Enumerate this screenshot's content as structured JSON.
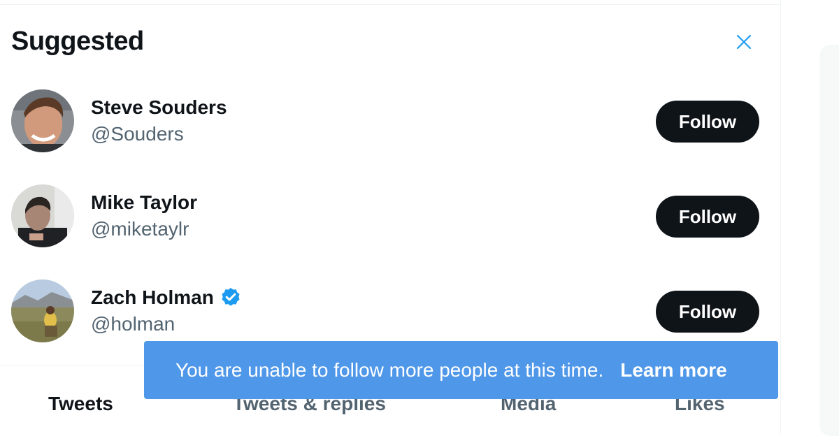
{
  "suggested": {
    "title": "Suggested",
    "close_icon": "close-icon",
    "users": [
      {
        "name": "Steve Souders",
        "handle": "@Souders",
        "verified": false,
        "follow_label": "Follow"
      },
      {
        "name": "Mike Taylor",
        "handle": "@miketaylr",
        "verified": false,
        "follow_label": "Follow"
      },
      {
        "name": "Zach Holman",
        "handle": "@holman",
        "verified": true,
        "follow_label": "Follow"
      }
    ]
  },
  "tabs": [
    {
      "label": "Tweets",
      "active": true
    },
    {
      "label": "Tweets & replies",
      "active": false
    },
    {
      "label": "Media",
      "active": false
    },
    {
      "label": "Likes",
      "active": false
    }
  ],
  "toast": {
    "message": "You are unable to follow more people at this time.",
    "link_label": "Learn more"
  },
  "colors": {
    "accent": "#1d9bf0",
    "toast_bg": "#4f97e8",
    "button_bg": "#0f1419",
    "text_primary": "#0f1419",
    "text_secondary": "#536471"
  }
}
